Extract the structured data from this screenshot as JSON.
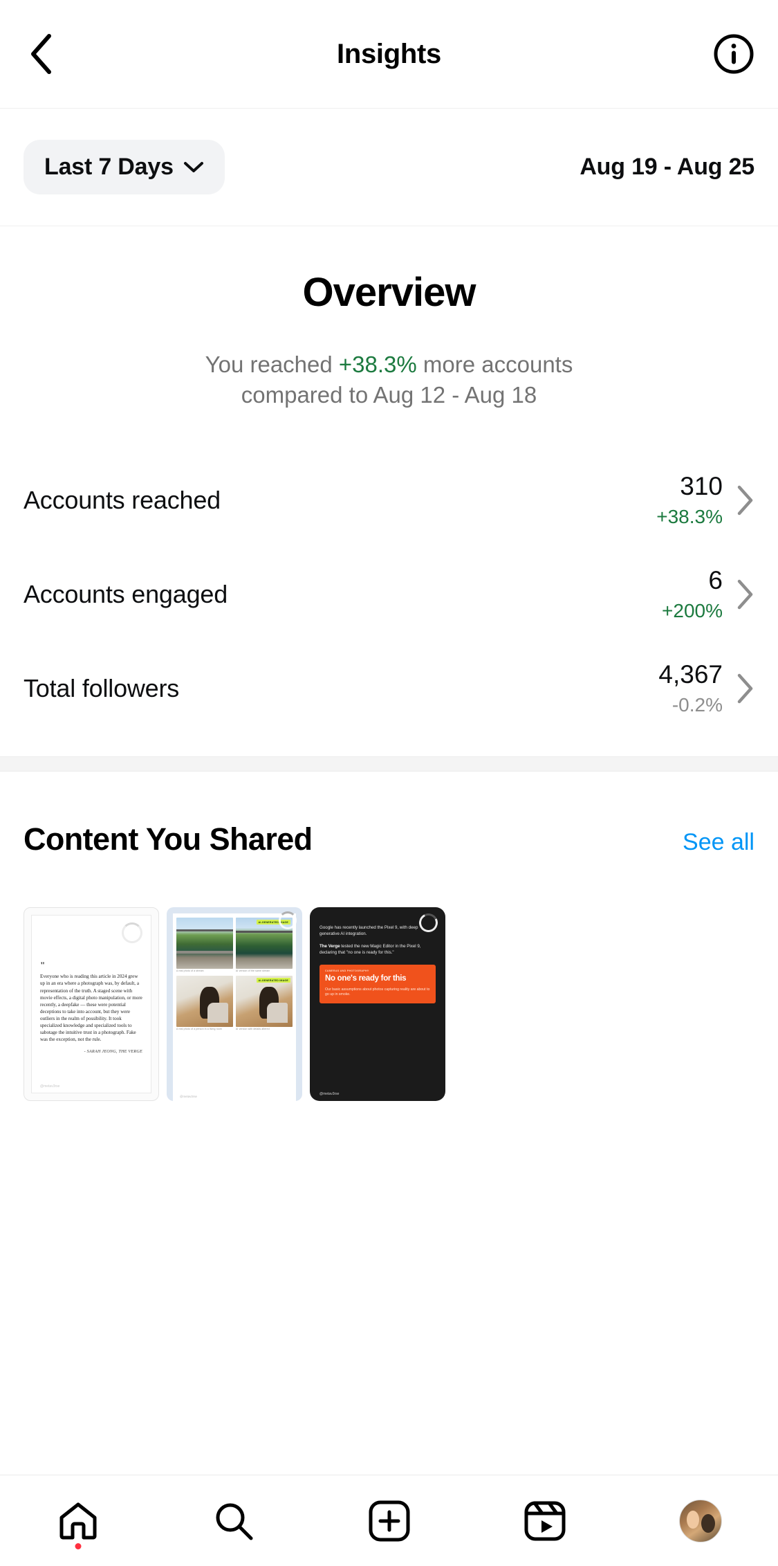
{
  "nav": {
    "back_icon": "chevron-left-icon",
    "title": "Insights",
    "info_icon": "info-circle-icon"
  },
  "filter": {
    "range_label": "Last 7 Days",
    "chevron_icon": "chevron-down-icon",
    "date_range": "Aug 19 - Aug 25"
  },
  "overview": {
    "title": "Overview",
    "summary_prefix": "You reached ",
    "summary_delta": "+38.3%",
    "summary_suffix": " more accounts",
    "summary_line2": "compared to Aug 12 - Aug 18",
    "delta_color": "#1c7a3f",
    "metrics": [
      {
        "label": "Accounts reached",
        "value": "310",
        "delta": "+38.3%",
        "direction": "up",
        "chevron_icon": "chevron-right-icon"
      },
      {
        "label": "Accounts engaged",
        "value": "6",
        "delta": "+200%",
        "direction": "up",
        "chevron_icon": "chevron-right-icon"
      },
      {
        "label": "Total followers",
        "value": "4,367",
        "delta": "-0.2%",
        "direction": "down",
        "chevron_icon": "chevron-right-icon"
      }
    ]
  },
  "content": {
    "title": "Content You Shared",
    "see_all": "See all",
    "see_all_color": "#0095f6",
    "posts": [
      {
        "type": "quote-card",
        "quote_mark": "\"",
        "body": "Everyone who is reading this article in 2024 grew up in an era where a photograph was, by default, a representation of the truth. A staged scene with movie effects, a digital photo manipulation, or more recently, a deepfake — these were potential deceptions to take into account, but they were outliers in the realm of possibility. It took specialized knowledge and specialized tools to sabotage the intuitive trust in a photograph. Fake was the exception, not the rule.",
        "attribution": "- SARAH JEONG, THE VERGE",
        "handle": "@metav3rse"
      },
      {
        "type": "photo-grid",
        "badge_label": "AI-GENERATED IMAGE",
        "badge_color": "#d6f24a",
        "captions": [
          "A real photo of a stream",
          "AI version of the same stream",
          "A real photo of a person in a living room",
          "AI version with details altered"
        ],
        "handle": "@metav3rse"
      },
      {
        "type": "dark-article-card",
        "paragraph1": "Google has recently launched the Pixel 9, with deep generative AI integration.",
        "paragraph2_bold": "The Verge",
        "paragraph2": " tested the new Magic Editor in the Pixel 9, declaring that \"no one is ready for this.\"",
        "card_kicker": "CAMERAS  AND  PHOTOGRAPHY",
        "card_headline": "No one's ready for this",
        "card_sub": "Our basic assumptions about photos capturing reality are about to go up in smoke.",
        "card_color": "#f0521c",
        "handle": "@metav3rse"
      }
    ]
  },
  "tabbar": {
    "items": [
      {
        "icon": "home-icon",
        "active": true,
        "badge": true
      },
      {
        "icon": "search-icon",
        "active": false,
        "badge": false
      },
      {
        "icon": "create-plus-icon",
        "active": false,
        "badge": false
      },
      {
        "icon": "reels-icon",
        "active": false,
        "badge": false
      },
      {
        "icon": "profile-avatar-icon",
        "active": false,
        "badge": false
      }
    ]
  }
}
